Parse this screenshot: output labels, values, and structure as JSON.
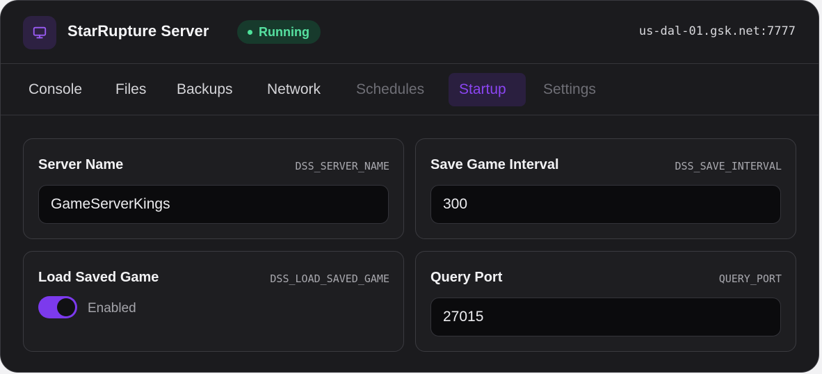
{
  "header": {
    "server_name": "StarRupture Server",
    "status": "Running",
    "address": "us-dal-01.gsk.net:7777",
    "icon": "monitor-icon"
  },
  "tabs": [
    {
      "label": "Console",
      "state": "normal"
    },
    {
      "label": "Files",
      "state": "normal"
    },
    {
      "label": "Backups",
      "state": "normal"
    },
    {
      "label": "Network",
      "state": "normal"
    },
    {
      "label": "Schedules",
      "state": "disabled"
    },
    {
      "label": "Startup",
      "state": "active"
    },
    {
      "label": "Settings",
      "state": "disabled"
    }
  ],
  "variables": {
    "server_name": {
      "label": "Server Name",
      "env": "DSS_SERVER_NAME",
      "value": "GameServerKings"
    },
    "save_interval": {
      "label": "Save Game Interval",
      "env": "DSS_SAVE_INTERVAL",
      "value": "300"
    },
    "load_saved_game": {
      "label": "Load Saved Game",
      "env": "DSS_LOAD_SAVED_GAME",
      "enabled": true,
      "toggle_text": "Enabled"
    },
    "query_port": {
      "label": "Query Port",
      "env": "QUERY_PORT",
      "value": "27015"
    }
  },
  "colors": {
    "accent": "#7c3aed",
    "status_green": "#4ee29b",
    "background": "#1b1b1e"
  }
}
